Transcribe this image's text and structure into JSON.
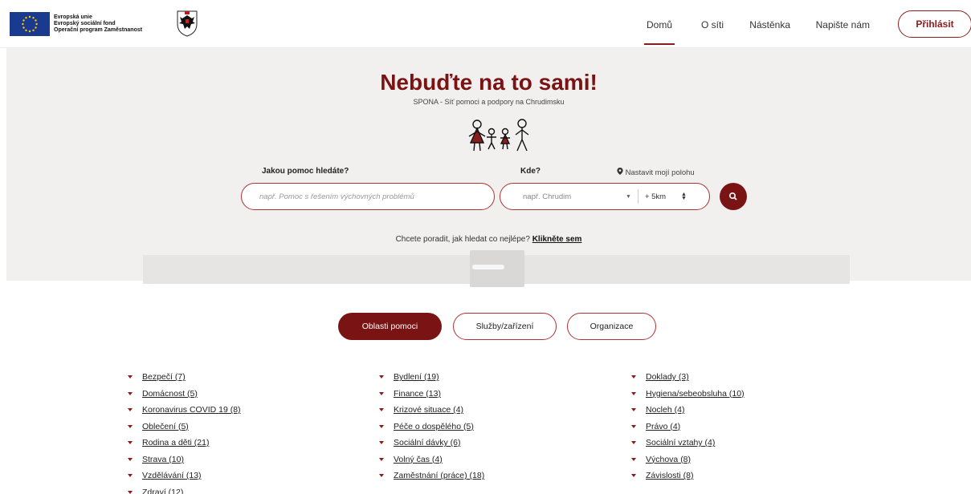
{
  "header": {
    "eu_text": [
      "Evropská unie",
      "Evropský sociální fond",
      "Operační program Zaměstnanost"
    ],
    "nav": [
      {
        "label": "Domů",
        "active": true
      },
      {
        "label": "O síti",
        "active": false
      },
      {
        "label": "Nástěnka",
        "active": false
      },
      {
        "label": "Napište nám",
        "active": false
      }
    ],
    "login_label": "Přihlásit"
  },
  "hero": {
    "title": "Nebuďte na to sami!",
    "subtitle": "SPONA - Síť pomoci a podpory na Chrudimsku",
    "what_label": "Jakou pomoc hledáte?",
    "what_placeholder": "např. Pomoc s řešením výchovných problémů",
    "where_label": "Kde?",
    "location_link": "Nastavit mojí polohu",
    "where_placeholder": "např. Chrudim",
    "radius": "+ 5km",
    "help_text": "Chcete poradit, jak hledat co nejlépe?",
    "help_link": "Klikněte sem"
  },
  "tabs": [
    "Oblasti pomoci",
    "Služby/zařízení",
    "Organizace"
  ],
  "categories": {
    "col1": [
      "Bezpečí (7)",
      "Domácnost (5)",
      "Koronavirus COVID 19 (8)",
      "Oblečení (5)",
      "Rodina a děti (21)",
      "Strava (10)",
      "Vzdělávání (13)",
      "Zdraví (12)"
    ],
    "col2": [
      "Bydlení (19)",
      "Finance (13)",
      "Krizové situace (4)",
      "Péče o dospělého (5)",
      "Sociální dávky (6)",
      "Volný čas (4)",
      "Zaměstnání (práce) (18)"
    ],
    "col3": [
      "Doklady (3)",
      "Hygiena/sebeobsluha (10)",
      "Nocleh (4)",
      "Právo (4)",
      "Sociální vztahy (4)",
      "Výchova (8)",
      "Závislosti (8)"
    ]
  },
  "colors": {
    "brand": "#7a1414",
    "hero_bg": "#f1f0ef"
  },
  "icons": [
    "eu-flag-icon",
    "coat-of-arms-icon",
    "family-icon",
    "location-pin-icon",
    "search-icon",
    "dropdown-arrow-icon"
  ]
}
